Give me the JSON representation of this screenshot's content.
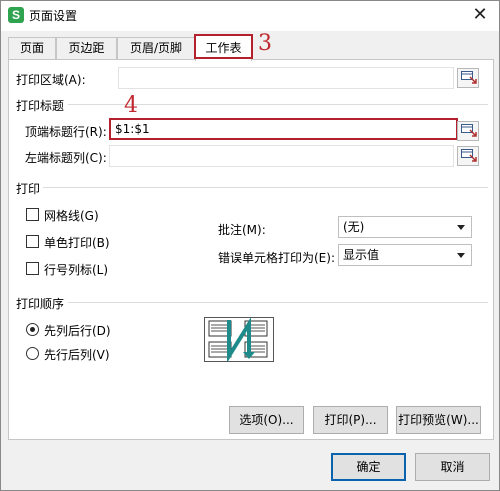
{
  "window": {
    "title": "页面设置",
    "app_icon_glyph": "S",
    "close_glyph": "✕"
  },
  "tabs": [
    {
      "label": "页面"
    },
    {
      "label": "页边距"
    },
    {
      "label": "页眉/页脚"
    },
    {
      "label": "工作表",
      "active": true
    }
  ],
  "annotations": {
    "tab_number": "3",
    "field_number": "4",
    "color": "#b4202c"
  },
  "print_area": {
    "label": "打印区域(A):",
    "value": ""
  },
  "print_titles": {
    "group_label": "打印标题",
    "top_rows": {
      "label": "顶端标题行(R):",
      "value": "$1:$1"
    },
    "left_cols": {
      "label": "左端标题列(C):",
      "value": ""
    }
  },
  "print": {
    "group_label": "打印",
    "gridlines": {
      "label": "网格线(G)",
      "checked": false
    },
    "black_white": {
      "label": "单色打印(B)",
      "checked": false
    },
    "row_col_headers": {
      "label": "行号列标(L)",
      "checked": false
    },
    "comments": {
      "label": "批注(M):",
      "value": "(无)"
    },
    "cell_errors": {
      "label": "错误单元格打印为(E):",
      "value": "显示值"
    }
  },
  "page_order": {
    "group_label": "打印顺序",
    "down_then_over": {
      "label": "先列后行(D)",
      "checked": true
    },
    "over_then_down": {
      "label": "先行后列(V)",
      "checked": false
    }
  },
  "buttons": {
    "options": "选项(O)...",
    "print": "打印(P)...",
    "print_preview": "打印预览(W)...",
    "ok": "确定",
    "cancel": "取消"
  },
  "colors": {
    "accent": "#1e8a8a",
    "app_icon": "#2fa34f"
  }
}
